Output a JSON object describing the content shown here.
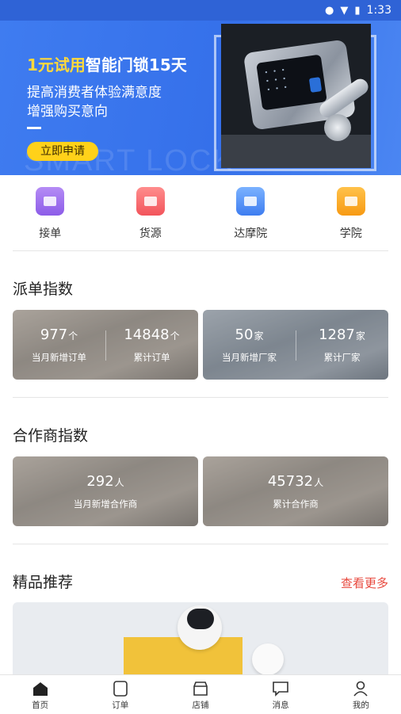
{
  "status_bar": {
    "time": "1:33",
    "icons": [
      "location-icon",
      "wifi-icon",
      "battery-icon"
    ]
  },
  "banner": {
    "title_highlight": "1元试用",
    "title_rest": "智能门锁15天",
    "line1": "提高消费者体验满意度",
    "line2": "增强购买意向",
    "cta": "立即申请",
    "watermark": "SMART LOCK"
  },
  "shortcuts": [
    {
      "label": "接单",
      "icon": "receive-order-icon"
    },
    {
      "label": "货源",
      "icon": "supply-box-icon"
    },
    {
      "label": "达摩院",
      "icon": "academy-house-icon"
    },
    {
      "label": "学院",
      "icon": "book-icon"
    }
  ],
  "dispatch_index": {
    "title": "派单指数",
    "cards": [
      {
        "left": {
          "value": "977",
          "unit": "个",
          "caption": "当月新增订单"
        },
        "right": {
          "value": "14848",
          "unit": "个",
          "caption": "累计订单"
        }
      },
      {
        "left": {
          "value": "50",
          "unit": "家",
          "caption": "当月新增厂家"
        },
        "right": {
          "value": "1287",
          "unit": "家",
          "caption": "累计厂家"
        }
      }
    ]
  },
  "partner_index": {
    "title": "合作商指数",
    "cards": [
      {
        "value": "292",
        "unit": "人",
        "caption": "当月新增合作商"
      },
      {
        "value": "45732",
        "unit": "人",
        "caption": "累计合作商"
      }
    ]
  },
  "featured": {
    "title": "精品推荐",
    "more": "查看更多"
  },
  "tabbar": [
    {
      "label": "首页",
      "icon": "home-icon",
      "active": true
    },
    {
      "label": "订单",
      "icon": "order-icon",
      "active": false
    },
    {
      "label": "店铺",
      "icon": "store-icon",
      "active": false
    },
    {
      "label": "消息",
      "icon": "message-icon",
      "active": false
    },
    {
      "label": "我的",
      "icon": "profile-icon",
      "active": false
    }
  ],
  "colors": {
    "status_bar": "#2f63d6",
    "banner": "#3a75ec",
    "highlight": "#ffd93b",
    "cta": "#ffd11a",
    "more_link": "#e84a3f"
  }
}
